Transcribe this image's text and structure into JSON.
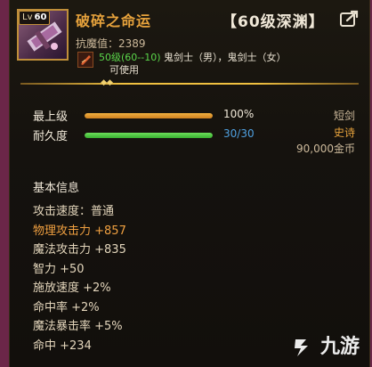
{
  "item": {
    "name": "破碎之命运",
    "level_label": "Lv",
    "level": "60",
    "tier_label": "【60级深渊】",
    "resist": "抗魔值：2389",
    "class_level": "50级(60--10)",
    "class_names": " 鬼剑士（男），鬼剑士（女）",
    "usable": "可使用"
  },
  "stats": {
    "upgrade_label": "最上级",
    "upgrade_value": "100%",
    "upgrade_fraction": 1.0,
    "durability_label": "耐久度",
    "durability_value": "30/30",
    "durability_fraction": 1.0
  },
  "side_info": {
    "weapon_type": "短剑",
    "rarity": "史诗",
    "price": "90,000金币"
  },
  "basic_info": {
    "title": "基本信息",
    "attrs": [
      {
        "text": "攻击速度：普通",
        "highlight": false
      },
      {
        "text": "物理攻击力 +857",
        "highlight": true
      },
      {
        "text": "魔法攻击力 +835",
        "highlight": false
      },
      {
        "text": "智力 +50",
        "highlight": false
      },
      {
        "text": "施放速度 +2%",
        "highlight": false
      },
      {
        "text": "命中率 +2%",
        "highlight": false
      },
      {
        "text": "魔法暴击率 +5%",
        "highlight": false
      },
      {
        "text": "命中 +234",
        "highlight": false
      }
    ]
  },
  "watermark": "九游",
  "colors": {
    "name": "#e6a23c",
    "rarity": "#e6a23c",
    "class_level": "#5bd64a",
    "durability_value": "#4fa0e0",
    "upgrade_value": "#f0e8d8",
    "bar_upgrade": "#e8a030",
    "bar_durability": "#52c840"
  },
  "icons": {
    "item": "broken-sword-icon",
    "class": "slayer-class-icon",
    "share": "share-icon",
    "watermark": "jiuyou-logo-icon"
  }
}
